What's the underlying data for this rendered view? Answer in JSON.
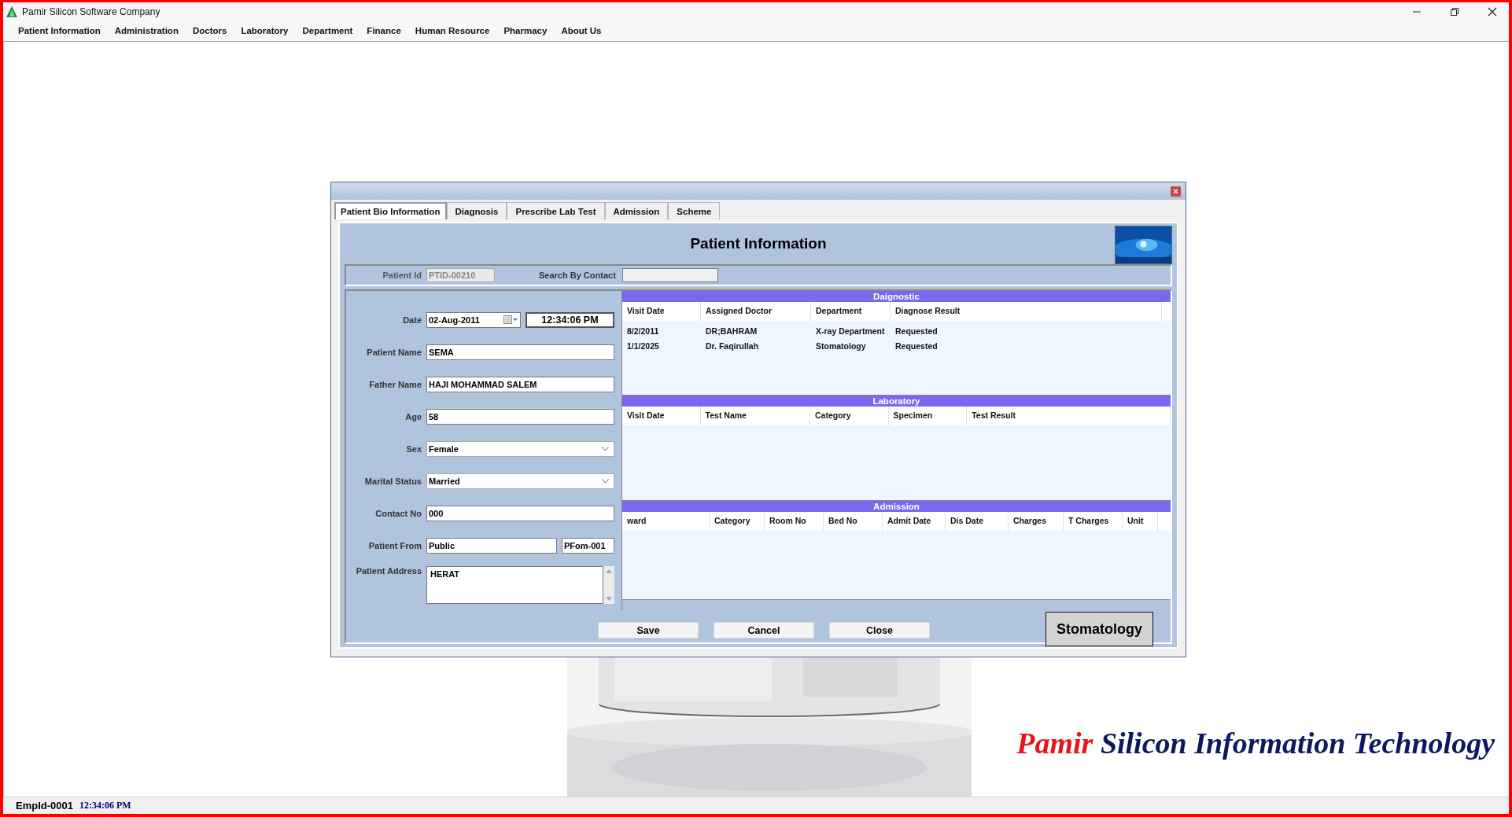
{
  "window": {
    "title": "Pamir Silicon Software Company"
  },
  "menu": [
    "Patient Information",
    "Administration",
    "Doctors",
    "Laboratory",
    "Department",
    "Finance",
    "Human Resource",
    "Pharmacy",
    "About Us"
  ],
  "dialog": {
    "tabs": [
      {
        "label": "Patient Bio Information",
        "selected": true
      },
      {
        "label": "Diagnosis",
        "selected": false
      },
      {
        "label": "Prescribe Lab Test",
        "selected": false
      },
      {
        "label": "Admission",
        "selected": false
      },
      {
        "label": "Scheme",
        "selected": false
      }
    ],
    "heading": "Patient Information",
    "patient_id": {
      "label": "Patient Id",
      "value": "PTID-00210",
      "disabled": true
    },
    "search_contact": {
      "label": "Search By Contact"
    },
    "fields": [
      {
        "kind": "date",
        "label": "Date",
        "value": "02-Aug-2011",
        "time": "12:34:06 PM"
      },
      {
        "kind": "text",
        "label": "Patient Name",
        "value": "SEMA"
      },
      {
        "kind": "text",
        "label": "Father Name",
        "value": "HAJI MOHAMMAD SALEM"
      },
      {
        "kind": "text",
        "label": "Age",
        "value": "58"
      },
      {
        "kind": "select",
        "label": "Sex",
        "value": "Female"
      },
      {
        "kind": "select",
        "label": "Marital Status",
        "value": "Married"
      },
      {
        "kind": "text",
        "label": "Contact No",
        "value": "000"
      },
      {
        "kind": "split",
        "label": "Patient From",
        "value": "Public",
        "code": "PFom-001"
      },
      {
        "kind": "textarea",
        "label": "Patient Address",
        "value": "HERAT"
      }
    ],
    "grids": [
      {
        "title": "Daignostic",
        "columns": [
          "Visit Date",
          "Assigned Doctor",
          "Department",
          "Diagnose Result"
        ],
        "rows": [
          [
            "8/2/2011",
            "DR;BAHRAM",
            "X-ray Department",
            "Requested"
          ],
          [
            "1/1/2025",
            "Dr. Faqirullah",
            "Stomatology",
            "Requested"
          ]
        ]
      },
      {
        "title": "Laboratory",
        "columns": [
          "Visit Date",
          "Test Name",
          "Category",
          "Specimen",
          "Test Result"
        ]
      },
      {
        "title": "Admission",
        "columns": [
          "ward",
          "Category",
          "Room No",
          "Bed No",
          "Admit Date",
          "Dis Date",
          "Charges",
          "T Charges",
          "Unit"
        ]
      }
    ],
    "buttons": [
      "Save",
      "Cancel",
      "Close"
    ],
    "department_button": "Stomatology"
  },
  "logo": {
    "first": "Pamir",
    "rest": "Silicon Information Technology"
  },
  "status_bar": {
    "employee": "EmpId-0001",
    "time": "12:34:06 PM"
  }
}
